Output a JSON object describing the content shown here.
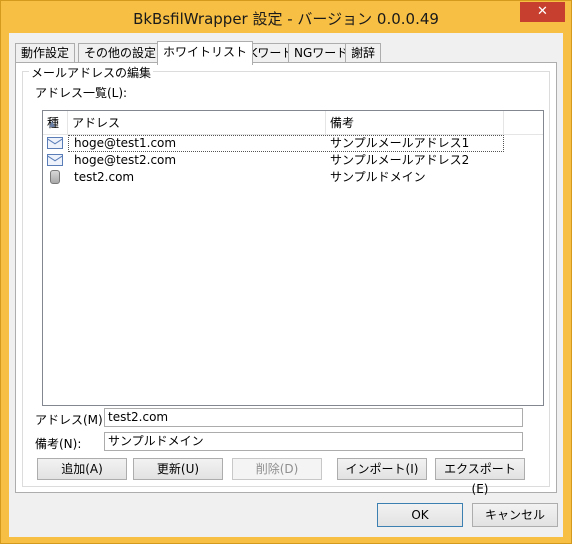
{
  "window": {
    "title": "BkBsfilWrapper 設定 - バージョン 0.0.0.49",
    "close_glyph": "✕"
  },
  "tabs": [
    {
      "label": "動作設定"
    },
    {
      "label": "その他の設定"
    },
    {
      "label": "ホワイトリスト"
    },
    {
      "label": "OKワード"
    },
    {
      "label": "NGワード"
    },
    {
      "label": "謝辞"
    }
  ],
  "active_tab": "ホワイトリスト",
  "group": {
    "title": "メールアドレスの編集",
    "list_label": "アドレス一覧(L):"
  },
  "list": {
    "columns": [
      {
        "label": "種"
      },
      {
        "label": "アドレス"
      },
      {
        "label": "備考"
      }
    ],
    "rows": [
      {
        "icon": "mail-icon",
        "address": "hoge@test1.com",
        "note": "サンプルメールアドレス1"
      },
      {
        "icon": "mail-icon",
        "address": "hoge@test2.com",
        "note": "サンプルメールアドレス2"
      },
      {
        "icon": "domain-icon",
        "address": "test2.com",
        "note": "サンプルドメイン"
      }
    ]
  },
  "form": {
    "address_label": "アドレス(M):",
    "address_value": "test2.com",
    "note_label": "備考(N):",
    "note_value": "サンプルドメイン"
  },
  "actions": {
    "add": "追加(A)",
    "update": "更新(U)",
    "delete": "削除(D)",
    "import": "インポート(I)",
    "export": "エクスポート(E)"
  },
  "footer": {
    "ok": "OK",
    "cancel": "キャンセル"
  }
}
